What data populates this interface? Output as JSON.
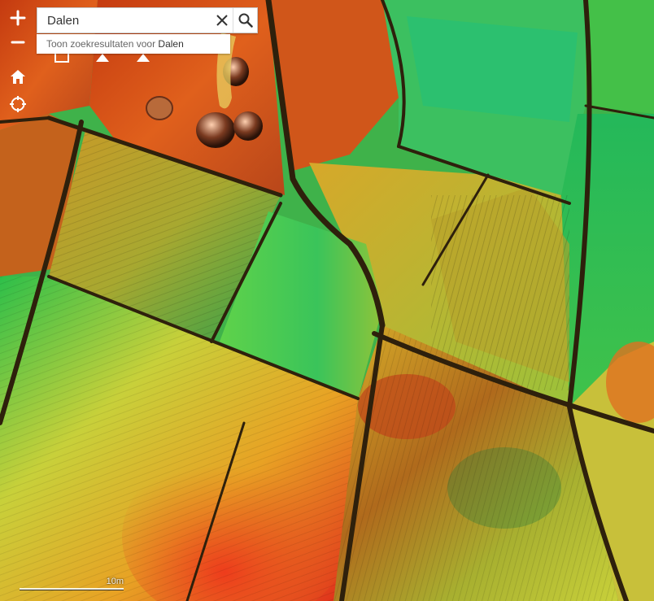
{
  "search": {
    "value": "Dalen"
  },
  "suggestion": {
    "prefix": "Toon zoekresultaten voor ",
    "term": "Dalen"
  },
  "controls": {
    "zoom_in": "+",
    "zoom_out": "−",
    "icons": [
      "zoom-in-icon",
      "zoom-out-icon",
      "home-icon",
      "locate-icon",
      "clear-icon",
      "search-icon"
    ]
  },
  "scale": {
    "label": "10m"
  },
  "colors": {
    "control_fg": "#ffffff",
    "elevation_high": "#e0281a",
    "elevation_mid": "#e8c52a",
    "elevation_low": "#2fbf4a",
    "road": "#3a2a10"
  }
}
